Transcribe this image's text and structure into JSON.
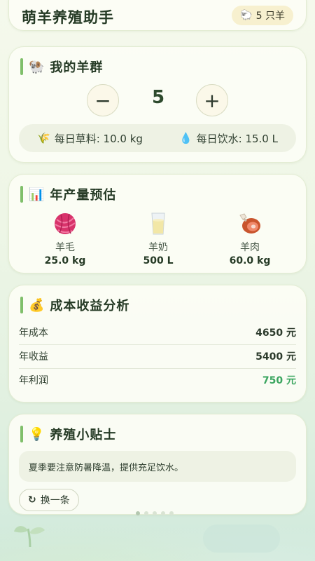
{
  "header": {
    "title": "萌羊养殖助手",
    "badge_icon": "🐑",
    "badge_text": "5 只羊"
  },
  "flock": {
    "section_icon": "🐏",
    "title": "我的羊群",
    "minus": "−",
    "count": "5",
    "plus": "+",
    "feed_icon": "🌾",
    "feed_text": "每日草料: 10.0 kg",
    "water_icon": "💧",
    "water_text": "每日饮水: 15.0 L"
  },
  "production": {
    "section_icon": "📊",
    "title": "年产量预估",
    "items": [
      {
        "icon": "yarn-ball-icon",
        "label": "羊毛",
        "value": "25.0 kg"
      },
      {
        "icon": "milk-glass-icon",
        "label": "羊奶",
        "value": "500 L"
      },
      {
        "icon": "meat-icon",
        "label": "羊肉",
        "value": "60.0 kg"
      }
    ]
  },
  "cost": {
    "section_icon": "💰",
    "title": "成本收益分析",
    "rows": [
      {
        "label": "年成本",
        "value": "4650 元"
      },
      {
        "label": "年收益",
        "value": "5400 元"
      },
      {
        "label": "年利润",
        "value": "750 元"
      }
    ],
    "profit_color": "#3aa55f"
  },
  "tips": {
    "section_icon": "💡",
    "title": "养殖小贴士",
    "text": "夏季要注意防暑降温，提供充足饮水。",
    "change_icon": "↻",
    "change_label": "换一条"
  },
  "colors": {
    "accent": "#7fbf6a",
    "background": "#eef6e6"
  }
}
